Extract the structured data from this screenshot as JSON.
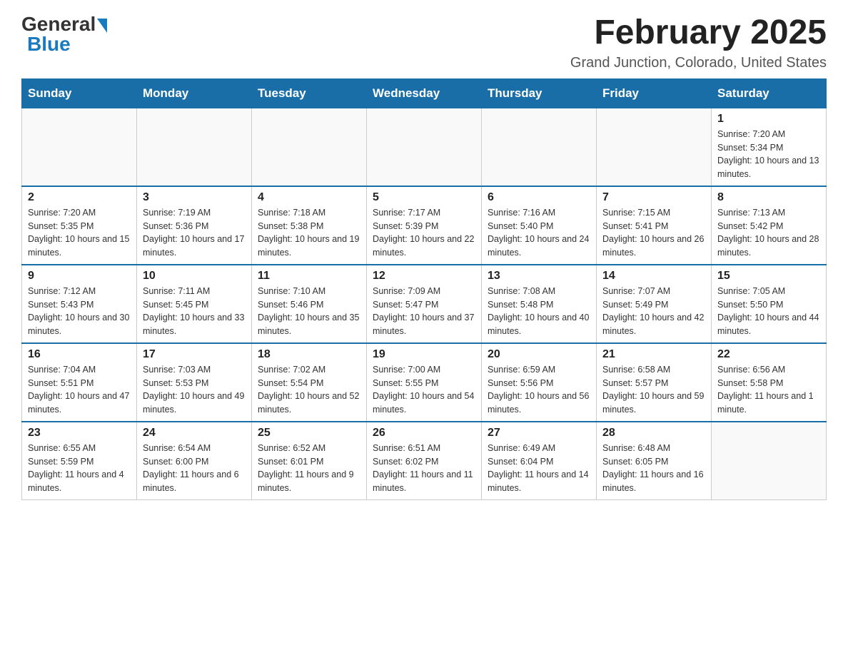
{
  "header": {
    "logo_general": "General",
    "logo_blue": "Blue",
    "title": "February 2025",
    "subtitle": "Grand Junction, Colorado, United States"
  },
  "days_of_week": [
    "Sunday",
    "Monday",
    "Tuesday",
    "Wednesday",
    "Thursday",
    "Friday",
    "Saturday"
  ],
  "weeks": [
    [
      {
        "day": "",
        "info": ""
      },
      {
        "day": "",
        "info": ""
      },
      {
        "day": "",
        "info": ""
      },
      {
        "day": "",
        "info": ""
      },
      {
        "day": "",
        "info": ""
      },
      {
        "day": "",
        "info": ""
      },
      {
        "day": "1",
        "info": "Sunrise: 7:20 AM\nSunset: 5:34 PM\nDaylight: 10 hours and 13 minutes."
      }
    ],
    [
      {
        "day": "2",
        "info": "Sunrise: 7:20 AM\nSunset: 5:35 PM\nDaylight: 10 hours and 15 minutes."
      },
      {
        "day": "3",
        "info": "Sunrise: 7:19 AM\nSunset: 5:36 PM\nDaylight: 10 hours and 17 minutes."
      },
      {
        "day": "4",
        "info": "Sunrise: 7:18 AM\nSunset: 5:38 PM\nDaylight: 10 hours and 19 minutes."
      },
      {
        "day": "5",
        "info": "Sunrise: 7:17 AM\nSunset: 5:39 PM\nDaylight: 10 hours and 22 minutes."
      },
      {
        "day": "6",
        "info": "Sunrise: 7:16 AM\nSunset: 5:40 PM\nDaylight: 10 hours and 24 minutes."
      },
      {
        "day": "7",
        "info": "Sunrise: 7:15 AM\nSunset: 5:41 PM\nDaylight: 10 hours and 26 minutes."
      },
      {
        "day": "8",
        "info": "Sunrise: 7:13 AM\nSunset: 5:42 PM\nDaylight: 10 hours and 28 minutes."
      }
    ],
    [
      {
        "day": "9",
        "info": "Sunrise: 7:12 AM\nSunset: 5:43 PM\nDaylight: 10 hours and 30 minutes."
      },
      {
        "day": "10",
        "info": "Sunrise: 7:11 AM\nSunset: 5:45 PM\nDaylight: 10 hours and 33 minutes."
      },
      {
        "day": "11",
        "info": "Sunrise: 7:10 AM\nSunset: 5:46 PM\nDaylight: 10 hours and 35 minutes."
      },
      {
        "day": "12",
        "info": "Sunrise: 7:09 AM\nSunset: 5:47 PM\nDaylight: 10 hours and 37 minutes."
      },
      {
        "day": "13",
        "info": "Sunrise: 7:08 AM\nSunset: 5:48 PM\nDaylight: 10 hours and 40 minutes."
      },
      {
        "day": "14",
        "info": "Sunrise: 7:07 AM\nSunset: 5:49 PM\nDaylight: 10 hours and 42 minutes."
      },
      {
        "day": "15",
        "info": "Sunrise: 7:05 AM\nSunset: 5:50 PM\nDaylight: 10 hours and 44 minutes."
      }
    ],
    [
      {
        "day": "16",
        "info": "Sunrise: 7:04 AM\nSunset: 5:51 PM\nDaylight: 10 hours and 47 minutes."
      },
      {
        "day": "17",
        "info": "Sunrise: 7:03 AM\nSunset: 5:53 PM\nDaylight: 10 hours and 49 minutes."
      },
      {
        "day": "18",
        "info": "Sunrise: 7:02 AM\nSunset: 5:54 PM\nDaylight: 10 hours and 52 minutes."
      },
      {
        "day": "19",
        "info": "Sunrise: 7:00 AM\nSunset: 5:55 PM\nDaylight: 10 hours and 54 minutes."
      },
      {
        "day": "20",
        "info": "Sunrise: 6:59 AM\nSunset: 5:56 PM\nDaylight: 10 hours and 56 minutes."
      },
      {
        "day": "21",
        "info": "Sunrise: 6:58 AM\nSunset: 5:57 PM\nDaylight: 10 hours and 59 minutes."
      },
      {
        "day": "22",
        "info": "Sunrise: 6:56 AM\nSunset: 5:58 PM\nDaylight: 11 hours and 1 minute."
      }
    ],
    [
      {
        "day": "23",
        "info": "Sunrise: 6:55 AM\nSunset: 5:59 PM\nDaylight: 11 hours and 4 minutes."
      },
      {
        "day": "24",
        "info": "Sunrise: 6:54 AM\nSunset: 6:00 PM\nDaylight: 11 hours and 6 minutes."
      },
      {
        "day": "25",
        "info": "Sunrise: 6:52 AM\nSunset: 6:01 PM\nDaylight: 11 hours and 9 minutes."
      },
      {
        "day": "26",
        "info": "Sunrise: 6:51 AM\nSunset: 6:02 PM\nDaylight: 11 hours and 11 minutes."
      },
      {
        "day": "27",
        "info": "Sunrise: 6:49 AM\nSunset: 6:04 PM\nDaylight: 11 hours and 14 minutes."
      },
      {
        "day": "28",
        "info": "Sunrise: 6:48 AM\nSunset: 6:05 PM\nDaylight: 11 hours and 16 minutes."
      },
      {
        "day": "",
        "info": ""
      }
    ]
  ]
}
